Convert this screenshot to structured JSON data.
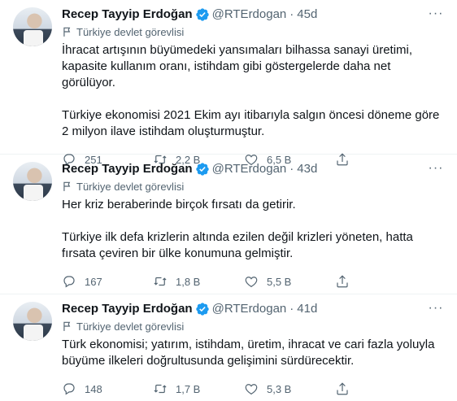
{
  "tweets": [
    {
      "name": "Recep Tayyip Erdoğan",
      "handle": "@RTErdogan",
      "separator": "·",
      "time": "45d",
      "label": "Türkiye devlet görevlisi",
      "paragraphs": [
        "İhracat artışının büyümedeki yansımaları bilhassa sanayi üretimi, kapasite kullanım oranı, istihdam gibi göstergelerde daha net görülüyor.",
        "Türkiye ekonomisi 2021 Ekim ayı itibarıyla salgın öncesi döneme göre 2 milyon ilave istihdam oluşturmuştur."
      ],
      "replies": "251",
      "retweets": "2,2 B",
      "likes": "6,5 B"
    },
    {
      "name": "Recep Tayyip Erdoğan",
      "handle": "@RTErdogan",
      "separator": "·",
      "time": "43d",
      "label": "Türkiye devlet görevlisi",
      "paragraphs": [
        "Her kriz beraberinde birçok fırsatı da getirir.",
        "Türkiye ilk defa krizlerin altında ezilen değil krizleri yöneten, hatta fırsata çeviren bir ülke konumuna gelmiştir."
      ],
      "replies": "167",
      "retweets": "1,8 B",
      "likes": "5,5 B"
    },
    {
      "name": "Recep Tayyip Erdoğan",
      "handle": "@RTErdogan",
      "separator": "·",
      "time": "41d",
      "label": "Türkiye devlet görevlisi",
      "paragraphs": [
        "Türk ekonomisi; yatırım, istihdam, üretim, ihracat ve cari fazla yoluyla büyüme ilkeleri doğrultusunda gelişimini sürdürecektir."
      ],
      "replies": "148",
      "retweets": "1,7 B",
      "likes": "5,3 B"
    }
  ],
  "icons": {
    "verified": "verified-badge-icon",
    "more": "more-icon",
    "label": "flag-icon",
    "reply": "reply-icon",
    "retweet": "retweet-icon",
    "like": "heart-icon",
    "share": "share-icon"
  },
  "colors": {
    "verified": "#1d9bf0",
    "secondary_text": "#536471",
    "primary_text": "#0f1419",
    "divider": "#eff3f4"
  }
}
